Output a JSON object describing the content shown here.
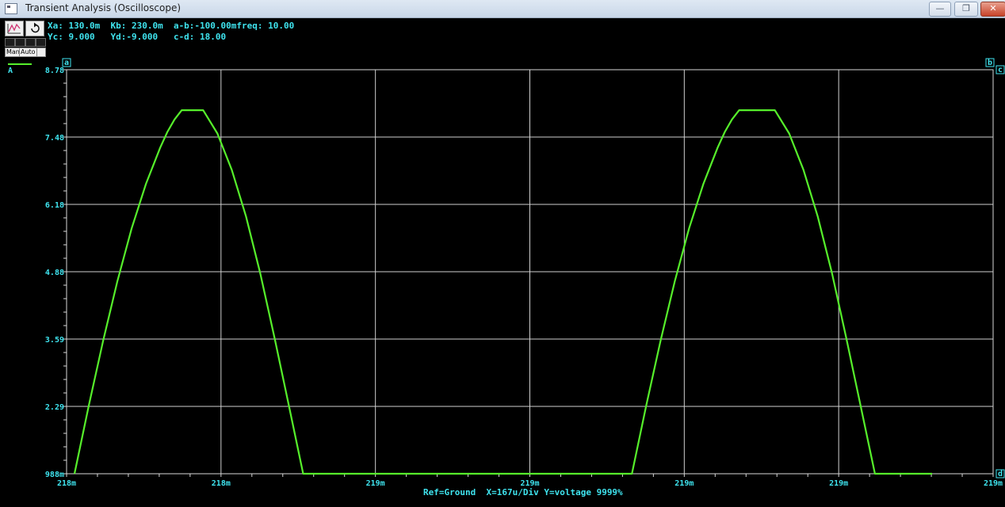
{
  "window": {
    "title": "Transient Analysis (Oscilloscope)"
  },
  "readouts": {
    "line1": "Xa: 130.0m  Kb: 230.0m  a-b:-100.00mfreq: 10.00",
    "line2": "Yc: 9.000   Yd:-9.000   c-d: 18.00"
  },
  "toolbar": {
    "man_label": "Man",
    "auto_label": "Auto"
  },
  "trace": {
    "label": "A",
    "color": "#56ef2b"
  },
  "cursors": {
    "a": "a",
    "b": "b",
    "c": "c",
    "d": "d"
  },
  "chart_data": {
    "type": "line",
    "y_ticks": [
      "8.78",
      "7.48",
      "6.18",
      "4.88",
      "3.59",
      "2.29",
      "988m"
    ],
    "x_ticks": [
      "218m",
      "218m",
      "219m",
      "219m",
      "219m",
      "219m",
      "219m"
    ],
    "ylim": [
      0.988,
      8.78
    ],
    "grid": true,
    "series": [
      {
        "name": "A",
        "x": [
          0,
          0.1,
          0.2,
          0.3,
          0.4,
          0.5,
          0.6,
          0.65,
          0.7,
          0.75,
          0.8,
          0.85,
          0.9,
          1.0,
          1.1,
          1.2,
          1.3,
          1.4,
          1.5,
          1.6,
          1.75,
          1.8,
          1.9,
          2.0,
          2.5,
          3.0,
          3.5,
          3.8,
          3.9,
          4.0,
          4.1,
          4.2,
          4.3,
          4.4,
          4.5,
          4.55,
          4.6,
          4.65,
          4.7,
          4.75,
          4.8,
          4.85,
          4.9,
          5.0,
          5.1,
          5.2,
          5.3,
          5.4,
          5.5,
          5.6,
          5.7,
          5.8,
          5.95,
          6.0
        ],
        "y": [
          0.988,
          2.3,
          3.55,
          4.7,
          5.72,
          6.58,
          7.28,
          7.58,
          7.82,
          8.0,
          8.0,
          8.0,
          8.0,
          7.55,
          6.85,
          5.95,
          4.85,
          3.6,
          2.3,
          0.988,
          0.988,
          0.988,
          0.988,
          0.988,
          0.988,
          0.988,
          0.988,
          0.988,
          0.988,
          2.3,
          3.55,
          4.7,
          5.72,
          6.58,
          7.28,
          7.58,
          7.82,
          8.0,
          8.0,
          8.0,
          8.0,
          8.0,
          8.0,
          7.55,
          6.85,
          5.95,
          4.85,
          3.6,
          2.3,
          0.988,
          0.988,
          0.988,
          0.988,
          0.988
        ]
      }
    ]
  },
  "status": {
    "ref": "Ref=Ground",
    "xdiv": "X=167u/Div",
    "ydiv": "Y=voltage 9999%"
  }
}
